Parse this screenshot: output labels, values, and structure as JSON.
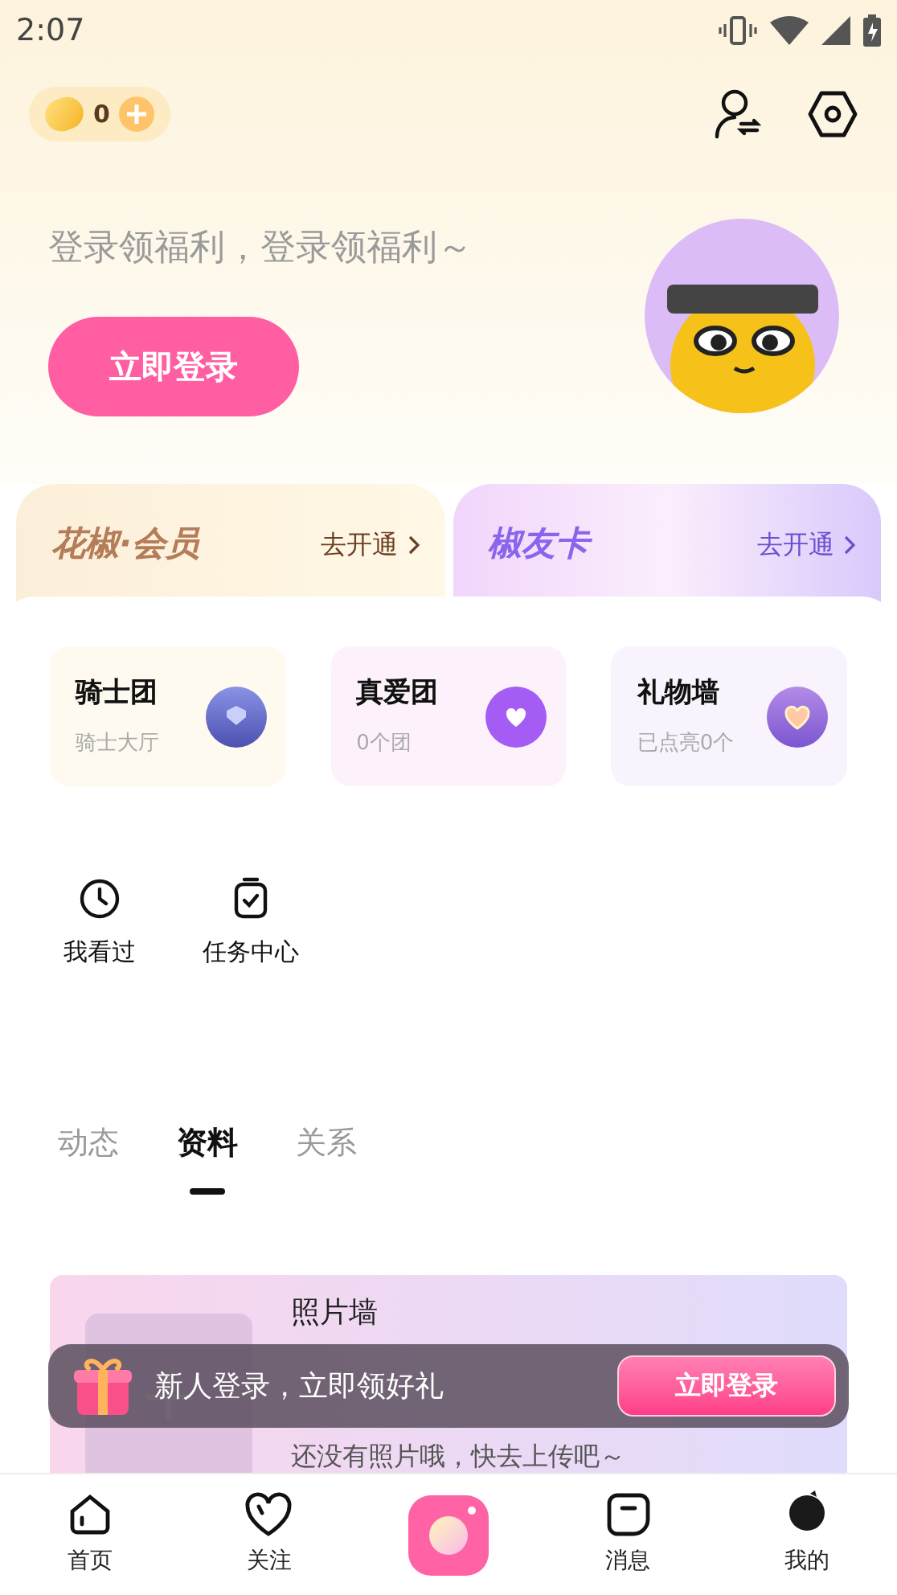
{
  "status_bar": {
    "time": "2:07"
  },
  "coins": {
    "count": "0"
  },
  "greeting": "登录领福利，登录领福利～",
  "login_button": "立即登录",
  "membership_cards": [
    {
      "kind": "gold",
      "title": "花椒·会员",
      "action": "去开通"
    },
    {
      "kind": "purple",
      "title": "椒友卡",
      "action": "去开通"
    }
  ],
  "features": [
    {
      "kind": "knight",
      "title": "骑士团",
      "subtitle": "骑士大厅"
    },
    {
      "kind": "love",
      "title": "真爱团",
      "subtitle": "0个团"
    },
    {
      "kind": "gift",
      "title": "礼物墙",
      "subtitle": "已点亮0个"
    }
  ],
  "shortcuts": [
    {
      "kind": "history",
      "label": "我看过"
    },
    {
      "kind": "tasks",
      "label": "任务中心"
    }
  ],
  "tabs": [
    {
      "label": "动态",
      "selected": false
    },
    {
      "label": "资料",
      "selected": true
    },
    {
      "label": "关系",
      "selected": false
    }
  ],
  "photo_wall": {
    "title": "照片墙",
    "subtitle": "还没有照片哦，快去上传吧～"
  },
  "promo_banner": {
    "text": "新人登录，立即领好礼",
    "button": "立即登录"
  },
  "bottom_nav": [
    {
      "kind": "home",
      "label": "首页"
    },
    {
      "kind": "follow",
      "label": "关注"
    },
    {
      "kind": "camera"
    },
    {
      "kind": "messages",
      "label": "消息"
    },
    {
      "kind": "profile",
      "label": "我的"
    }
  ]
}
